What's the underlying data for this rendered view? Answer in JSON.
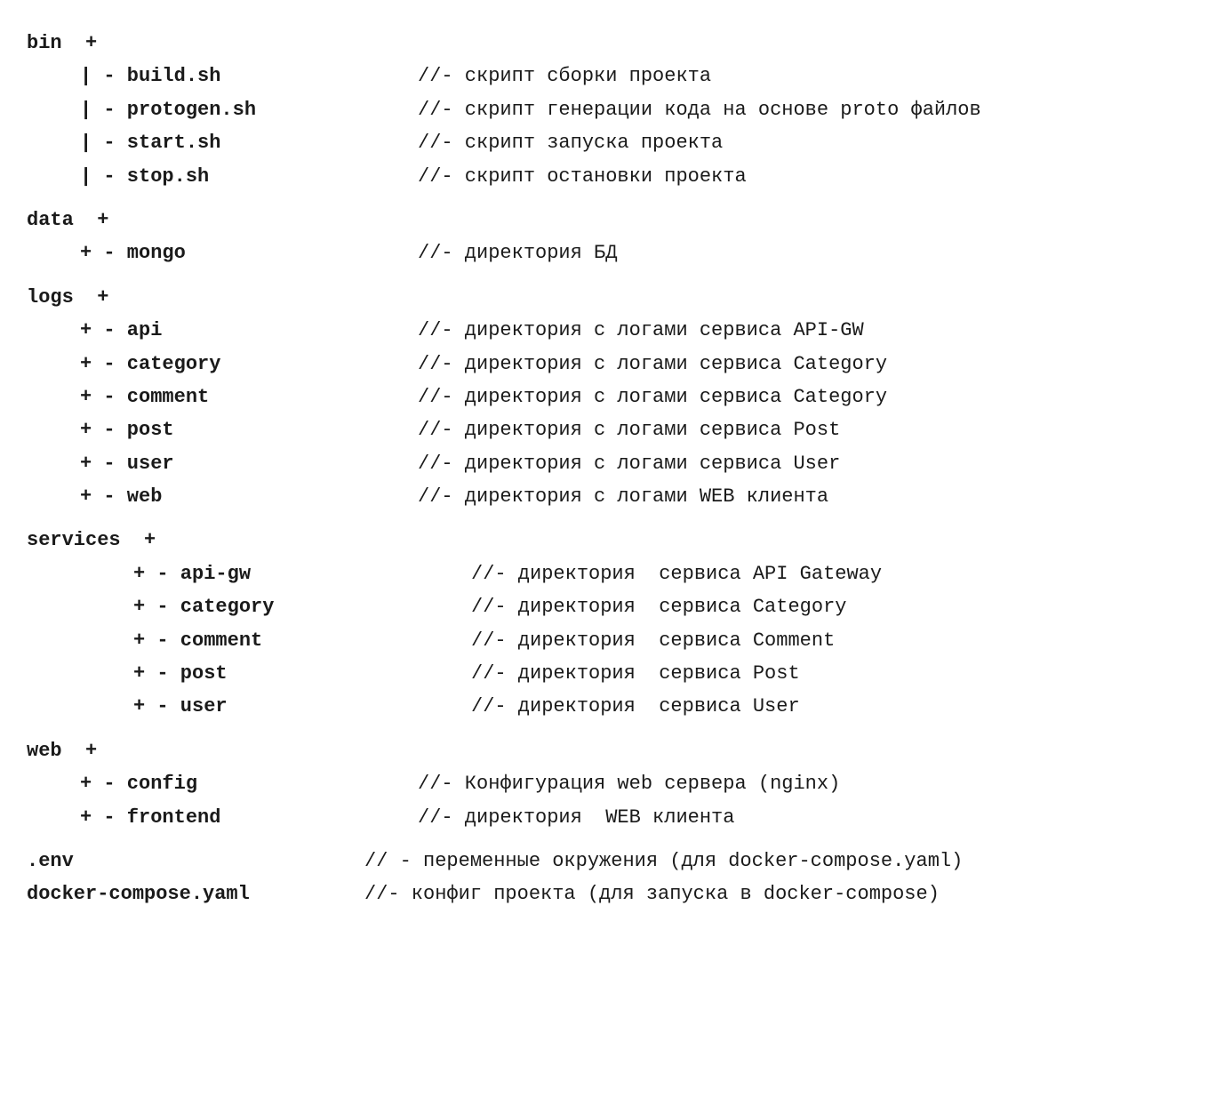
{
  "tree": {
    "rows": [
      {
        "id": "bin",
        "indent": 0,
        "name": "bin  +",
        "comment": ""
      },
      {
        "id": "build-sh",
        "indent": 1,
        "name": "| - build.sh",
        "comment": "//- скрипт сборки проекта"
      },
      {
        "id": "protogen-sh",
        "indent": 1,
        "name": "| - protogen.sh",
        "comment": "//- скрипт генерации кода на основе proto файлов"
      },
      {
        "id": "start-sh",
        "indent": 1,
        "name": "| - start.sh",
        "comment": "//- скрипт запуска проекта"
      },
      {
        "id": "stop-sh",
        "indent": 1,
        "name": "| - stop.sh",
        "comment": "//- скрипт остановки проекта"
      },
      {
        "id": "data",
        "indent": 0,
        "name": "data  +",
        "comment": "",
        "spacer_before": true
      },
      {
        "id": "mongo",
        "indent": 1,
        "name": "+ - mongo",
        "comment": "//- директория БД"
      },
      {
        "id": "logs",
        "indent": 0,
        "name": "logs  +",
        "comment": "",
        "spacer_before": true
      },
      {
        "id": "logs-api",
        "indent": 1,
        "name": "+ - api",
        "comment": "//- директория с логами сервиса API-GW"
      },
      {
        "id": "logs-category",
        "indent": 1,
        "name": "+ - category",
        "comment": "//- директория с логами сервиса Category"
      },
      {
        "id": "logs-comment",
        "indent": 1,
        "name": "+ - comment",
        "comment": "//- директория с логами сервиса Category"
      },
      {
        "id": "logs-post",
        "indent": 1,
        "name": "+ - post",
        "comment": "//- директория с логами сервиса Post"
      },
      {
        "id": "logs-user",
        "indent": 1,
        "name": "+ - user",
        "comment": "//- директория с логами сервиса User"
      },
      {
        "id": "logs-web",
        "indent": 1,
        "name": "+ - web",
        "comment": "//- директория с логами WEB клиента"
      },
      {
        "id": "services",
        "indent": 0,
        "name": "services  +",
        "comment": "",
        "spacer_before": true
      },
      {
        "id": "services-api-gw",
        "indent": 2,
        "name": "+ - api-gw",
        "comment": "//- директория  сервиса API Gateway"
      },
      {
        "id": "services-category",
        "indent": 2,
        "name": "+ - category",
        "comment": "//- директория  сервиса Category"
      },
      {
        "id": "services-comment",
        "indent": 2,
        "name": "+ - comment",
        "comment": "//- директория  сервиса Comment"
      },
      {
        "id": "services-post",
        "indent": 2,
        "name": "+ - post",
        "comment": "//- директория  сервиса Post"
      },
      {
        "id": "services-user",
        "indent": 2,
        "name": "+ - user",
        "comment": "//- директория  сервиса User"
      },
      {
        "id": "web",
        "indent": 0,
        "name": "web  +",
        "comment": "",
        "spacer_before": true
      },
      {
        "id": "web-config",
        "indent": 1,
        "name": "+ - config",
        "comment": "//- Конфигурация web сервера (nginx)"
      },
      {
        "id": "web-frontend",
        "indent": 1,
        "name": "+ - frontend",
        "comment": "//- директория  WEB клиента"
      },
      {
        "id": "env",
        "indent": 0,
        "name": ".env",
        "comment": "// - переменные окружения (для docker-compose.yaml)",
        "spacer_before": true
      },
      {
        "id": "docker-compose",
        "indent": 0,
        "name": "docker-compose.yaml",
        "comment": "//- конфиг проекта (для запуска в docker-compose)"
      }
    ]
  }
}
